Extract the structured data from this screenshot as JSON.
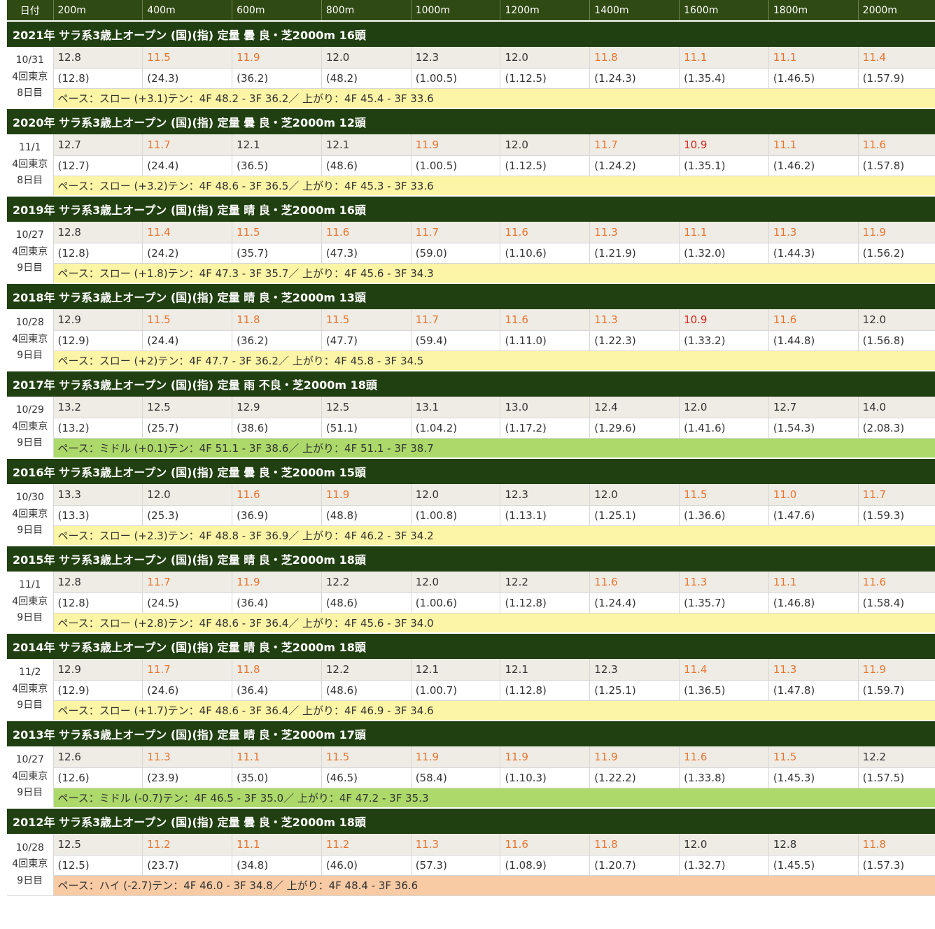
{
  "header": {
    "date_label": "日付",
    "distances": [
      "200m",
      "400m",
      "600m",
      "800m",
      "1000m",
      "1200m",
      "1400m",
      "1600m",
      "1800m",
      "2000m"
    ]
  },
  "colors": {
    "header_bg": "#2f4a12",
    "race_bg": "#214011",
    "fast_lap": "#e8742e",
    "fastest_lap": "#d7261e",
    "pace_slow": "#fcf5a5",
    "pace_middle": "#acd96a",
    "pace_high": "#f8cba5"
  },
  "races": [
    {
      "title": "2021年 サラ系3歳上オープン (国)(指) 定量 曇 良・芝2000m 16頭",
      "date": "10/31",
      "meeting": "4回東京",
      "day": "8日目",
      "laps": [
        "12.8",
        "11.5",
        "11.9",
        "12.0",
        "12.3",
        "12.0",
        "11.8",
        "11.1",
        "11.1",
        "11.4"
      ],
      "lap_hl": [
        "",
        "o",
        "o",
        "",
        "",
        "",
        "o",
        "o",
        "o",
        "o"
      ],
      "cumulative": [
        "(12.8)",
        "(24.3)",
        "(36.2)",
        "(48.2)",
        "(1.00.5)",
        "(1.12.5)",
        "(1.24.3)",
        "(1.35.4)",
        "(1.46.5)",
        "(1.57.9)"
      ],
      "pace": "ペース：スロー (+3.1)テン：4F 48.2 - 3F 36.2／ 上がり：4F 45.4 - 3F 33.6",
      "pace_type": "slow"
    },
    {
      "title": "2020年 サラ系3歳上オープン (国)(指) 定量 曇 良・芝2000m 12頭",
      "date": "11/1",
      "meeting": "4回東京",
      "day": "8日目",
      "laps": [
        "12.7",
        "11.7",
        "12.1",
        "12.1",
        "11.9",
        "12.0",
        "11.7",
        "10.9",
        "11.1",
        "11.6"
      ],
      "lap_hl": [
        "",
        "o",
        "",
        "",
        "o",
        "",
        "o",
        "r",
        "o",
        "o"
      ],
      "cumulative": [
        "(12.7)",
        "(24.4)",
        "(36.5)",
        "(48.6)",
        "(1.00.5)",
        "(1.12.5)",
        "(1.24.2)",
        "(1.35.1)",
        "(1.46.2)",
        "(1.57.8)"
      ],
      "pace": "ペース：スロー (+3.2)テン：4F 48.6 - 3F 36.5／ 上がり：4F 45.3 - 3F 33.6",
      "pace_type": "slow"
    },
    {
      "title": "2019年 サラ系3歳上オープン (国)(指) 定量 晴 良・芝2000m 16頭",
      "date": "10/27",
      "meeting": "4回東京",
      "day": "9日目",
      "laps": [
        "12.8",
        "11.4",
        "11.5",
        "11.6",
        "11.7",
        "11.6",
        "11.3",
        "11.1",
        "11.3",
        "11.9"
      ],
      "lap_hl": [
        "",
        "o",
        "o",
        "o",
        "o",
        "o",
        "o",
        "o",
        "o",
        "o"
      ],
      "cumulative": [
        "(12.8)",
        "(24.2)",
        "(35.7)",
        "(47.3)",
        "(59.0)",
        "(1.10.6)",
        "(1.21.9)",
        "(1.32.0)",
        "(1.44.3)",
        "(1.56.2)"
      ],
      "pace": "ペース：スロー (+1.8)テン：4F 47.3 - 3F 35.7／ 上がり：4F 45.6 - 3F 34.3",
      "pace_type": "slow"
    },
    {
      "title": "2018年 サラ系3歳上オープン (国)(指) 定量 晴 良・芝2000m 13頭",
      "date": "10/28",
      "meeting": "4回東京",
      "day": "9日目",
      "laps": [
        "12.9",
        "11.5",
        "11.8",
        "11.5",
        "11.7",
        "11.6",
        "11.3",
        "10.9",
        "11.6",
        "12.0"
      ],
      "lap_hl": [
        "",
        "o",
        "o",
        "o",
        "o",
        "o",
        "o",
        "r",
        "o",
        ""
      ],
      "cumulative": [
        "(12.9)",
        "(24.4)",
        "(36.2)",
        "(47.7)",
        "(59.4)",
        "(1.11.0)",
        "(1.22.3)",
        "(1.33.2)",
        "(1.44.8)",
        "(1.56.8)"
      ],
      "pace": "ペース：スロー (+2)テン：4F 47.7 - 3F 36.2／ 上がり：4F 45.8 - 3F 34.5",
      "pace_type": "slow"
    },
    {
      "title": "2017年 サラ系3歳上オープン (国)(指) 定量 雨 不良・芝2000m 18頭",
      "date": "10/29",
      "meeting": "4回東京",
      "day": "9日目",
      "laps": [
        "13.2",
        "12.5",
        "12.9",
        "12.5",
        "13.1",
        "13.0",
        "12.4",
        "12.0",
        "12.7",
        "14.0"
      ],
      "lap_hl": [
        "",
        "",
        "",
        "",
        "",
        "",
        "",
        "",
        "",
        ""
      ],
      "cumulative": [
        "(13.2)",
        "(25.7)",
        "(38.6)",
        "(51.1)",
        "(1.04.2)",
        "(1.17.2)",
        "(1.29.6)",
        "(1.41.6)",
        "(1.54.3)",
        "(2.08.3)"
      ],
      "pace": "ペース：ミドル (+0.1)テン：4F 51.1 - 3F 38.6／ 上がり：4F 51.1 - 3F 38.7",
      "pace_type": "middle"
    },
    {
      "title": "2016年 サラ系3歳上オープン (国)(指) 定量 曇 良・芝2000m 15頭",
      "date": "10/30",
      "meeting": "4回東京",
      "day": "9日目",
      "laps": [
        "13.3",
        "12.0",
        "11.6",
        "11.9",
        "12.0",
        "12.3",
        "12.0",
        "11.5",
        "11.0",
        "11.7"
      ],
      "lap_hl": [
        "",
        "",
        "o",
        "o",
        "",
        "",
        "",
        "o",
        "o",
        "o"
      ],
      "cumulative": [
        "(13.3)",
        "(25.3)",
        "(36.9)",
        "(48.8)",
        "(1.00.8)",
        "(1.13.1)",
        "(1.25.1)",
        "(1.36.6)",
        "(1.47.6)",
        "(1.59.3)"
      ],
      "pace": "ペース：スロー (+2.3)テン：4F 48.8 - 3F 36.9／ 上がり：4F 46.2 - 3F 34.2",
      "pace_type": "slow"
    },
    {
      "title": "2015年 サラ系3歳上オープン (国)(指) 定量 晴 良・芝2000m 18頭",
      "date": "11/1",
      "meeting": "4回東京",
      "day": "9日目",
      "laps": [
        "12.8",
        "11.7",
        "11.9",
        "12.2",
        "12.0",
        "12.2",
        "11.6",
        "11.3",
        "11.1",
        "11.6"
      ],
      "lap_hl": [
        "",
        "o",
        "o",
        "",
        "",
        "",
        "o",
        "o",
        "o",
        "o"
      ],
      "cumulative": [
        "(12.8)",
        "(24.5)",
        "(36.4)",
        "(48.6)",
        "(1.00.6)",
        "(1.12.8)",
        "(1.24.4)",
        "(1.35.7)",
        "(1.46.8)",
        "(1.58.4)"
      ],
      "pace": "ペース：スロー (+2.8)テン：4F 48.6 - 3F 36.4／ 上がり：4F 45.6 - 3F 34.0",
      "pace_type": "slow"
    },
    {
      "title": "2014年 サラ系3歳上オープン (国)(指) 定量 晴 良・芝2000m 18頭",
      "date": "11/2",
      "meeting": "4回東京",
      "day": "9日目",
      "laps": [
        "12.9",
        "11.7",
        "11.8",
        "12.2",
        "12.1",
        "12.1",
        "12.3",
        "11.4",
        "11.3",
        "11.9"
      ],
      "lap_hl": [
        "",
        "o",
        "o",
        "",
        "",
        "",
        "",
        "o",
        "o",
        "o"
      ],
      "cumulative": [
        "(12.9)",
        "(24.6)",
        "(36.4)",
        "(48.6)",
        "(1.00.7)",
        "(1.12.8)",
        "(1.25.1)",
        "(1.36.5)",
        "(1.47.8)",
        "(1.59.7)"
      ],
      "pace": "ペース：スロー (+1.7)テン：4F 48.6 - 3F 36.4／ 上がり：4F 46.9 - 3F 34.6",
      "pace_type": "slow"
    },
    {
      "title": "2013年 サラ系3歳上オープン (国)(指) 定量 晴 良・芝2000m 17頭",
      "date": "10/27",
      "meeting": "4回東京",
      "day": "9日目",
      "laps": [
        "12.6",
        "11.3",
        "11.1",
        "11.5",
        "11.9",
        "11.9",
        "11.9",
        "11.6",
        "11.5",
        "12.2"
      ],
      "lap_hl": [
        "",
        "o",
        "o",
        "o",
        "o",
        "o",
        "o",
        "o",
        "o",
        ""
      ],
      "cumulative": [
        "(12.6)",
        "(23.9)",
        "(35.0)",
        "(46.5)",
        "(58.4)",
        "(1.10.3)",
        "(1.22.2)",
        "(1.33.8)",
        "(1.45.3)",
        "(1.57.5)"
      ],
      "pace": "ペース：ミドル (-0.7)テン：4F 46.5 - 3F 35.0／ 上がり：4F 47.2 - 3F 35.3",
      "pace_type": "middle"
    },
    {
      "title": "2012年 サラ系3歳上オープン (国)(指) 定量 曇 良・芝2000m 18頭",
      "date": "10/28",
      "meeting": "4回東京",
      "day": "9日目",
      "laps": [
        "12.5",
        "11.2",
        "11.1",
        "11.2",
        "11.3",
        "11.6",
        "11.8",
        "12.0",
        "12.8",
        "11.8"
      ],
      "lap_hl": [
        "",
        "o",
        "o",
        "o",
        "o",
        "o",
        "o",
        "",
        "",
        "o"
      ],
      "cumulative": [
        "(12.5)",
        "(23.7)",
        "(34.8)",
        "(46.0)",
        "(57.3)",
        "(1.08.9)",
        "(1.20.7)",
        "(1.32.7)",
        "(1.45.5)",
        "(1.57.3)"
      ],
      "pace": "ペース：ハイ (-2.7)テン：4F 46.0 - 3F 34.8／ 上がり：4F 48.4 - 3F 36.6",
      "pace_type": "high"
    }
  ]
}
